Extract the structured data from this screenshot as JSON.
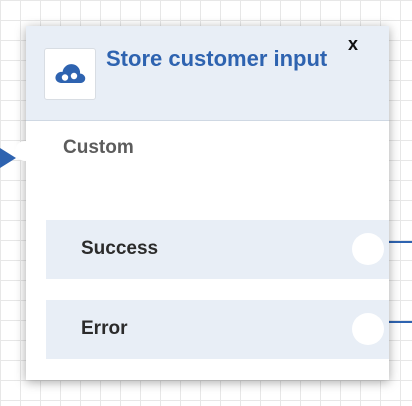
{
  "block": {
    "title": "Store customer input",
    "close_label": "x",
    "type_label": "Custom",
    "icon": "cloud-icon"
  },
  "branches": [
    {
      "label": "Success"
    },
    {
      "label": "Error"
    }
  ],
  "colors": {
    "accent": "#2e63b0",
    "header_bg": "#e8eef6",
    "branch_bg": "#e8eef6",
    "grid": "#e7e7e7"
  }
}
